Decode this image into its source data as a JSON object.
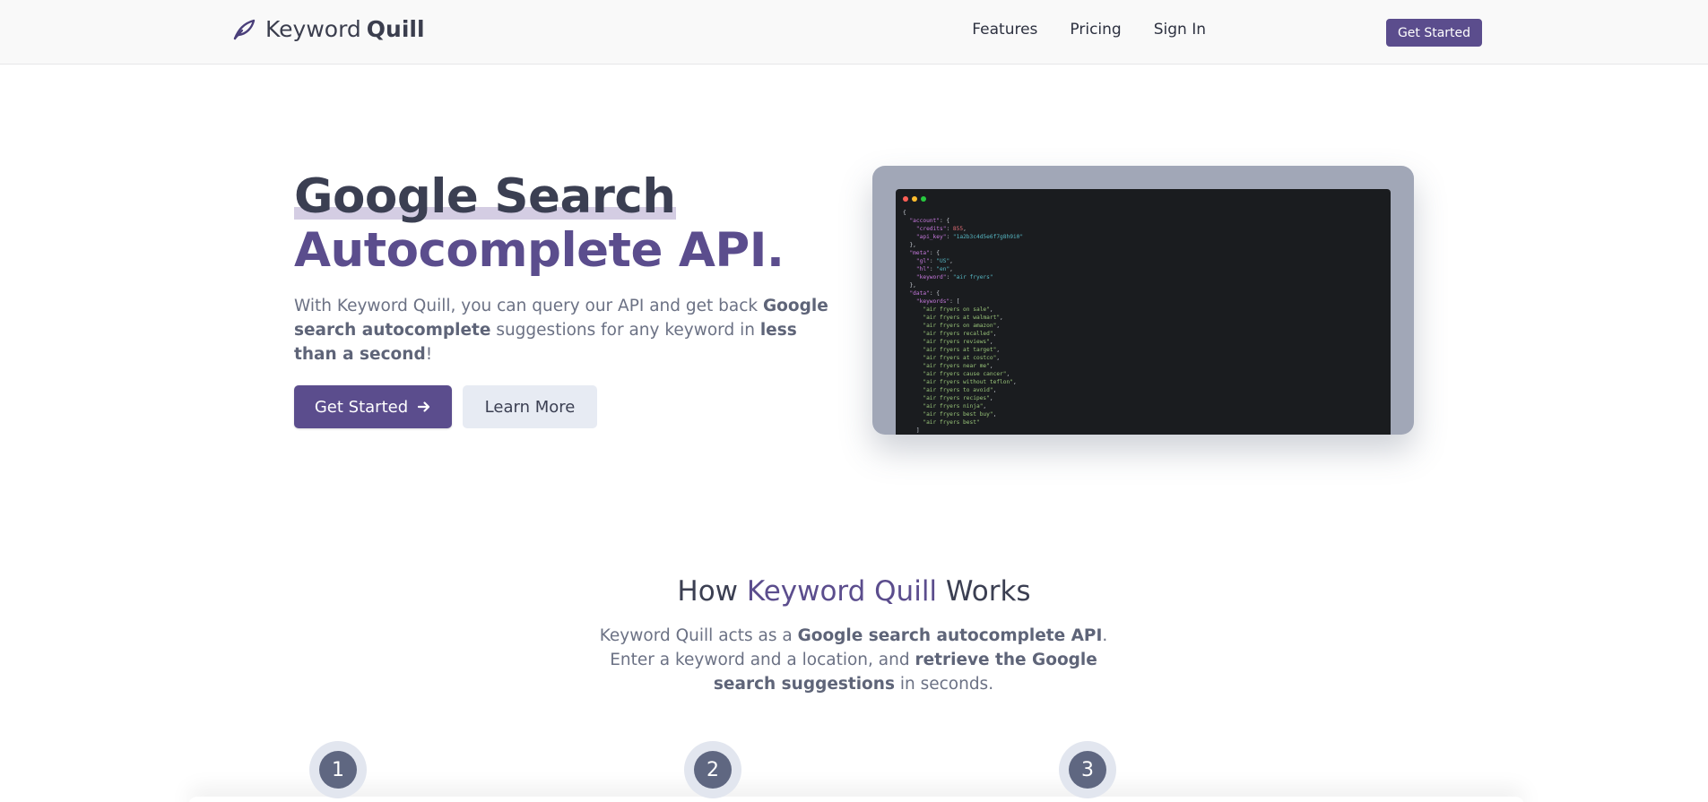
{
  "brand": {
    "name_regular": "Keyword",
    "name_bold": "Quill",
    "icon": "quill-icon"
  },
  "nav": {
    "links": [
      "Features",
      "Pricing",
      "Sign In"
    ],
    "cta": "Get Started"
  },
  "hero": {
    "title_line1": "Google Search",
    "title_line2": "Autocomplete API.",
    "desc": {
      "p1": "With Keyword Quill, you can query our API and get back ",
      "b1": "Google search autocomplete",
      "p2": " suggestions for any keyword in ",
      "b2": "less than a second",
      "p3": "!"
    },
    "primary_button": "Get Started",
    "secondary_button": "Learn More"
  },
  "code_sample": {
    "lines": [
      "{",
      "  \"account\": {",
      "    \"credits\": 855,",
      "    \"api_key\": \"1a2b3c4d5e6f7g8h9i0\"",
      "  },",
      "  \"meta\": {",
      "    \"gl\": \"US\",",
      "    \"hl\": \"en\",",
      "    \"keyword\": \"air fryers\"",
      "  },",
      "  \"data\": {",
      "    \"keywords\": [",
      "      \"air fryers on sale\",",
      "      \"air fryers at walmart\",",
      "      \"air fryers on amazon\",",
      "      \"air fryers recalled\",",
      "      \"air fryers reviews\",",
      "      \"air fryers at target\",",
      "      \"air fryers at costco\",",
      "      \"air fryers near me\",",
      "      \"air fryers cause cancer\",",
      "      \"air fryers without teflon\",",
      "      \"air fryers to avoid\",",
      "      \"air fryers recipes\",",
      "      \"air fryers ninja\",",
      "      \"air fryers best buy\",",
      "      \"air fryers best\"",
      "    ]",
      "  }"
    ]
  },
  "how": {
    "title_pre": "How ",
    "title_accent": "Keyword Quill",
    "title_post": " Works",
    "desc": {
      "p1": "Keyword Quill acts as a ",
      "b1": "Google search autocomplete API",
      "p2": ". Enter a keyword and a location, and ",
      "b2": "retrieve the Google search suggestions",
      "p3": " in seconds."
    },
    "steps": [
      "1",
      "2",
      "3"
    ]
  },
  "colors": {
    "accent": "#5b4d8d",
    "text": "#3b3f52",
    "muted": "#6b7184"
  }
}
